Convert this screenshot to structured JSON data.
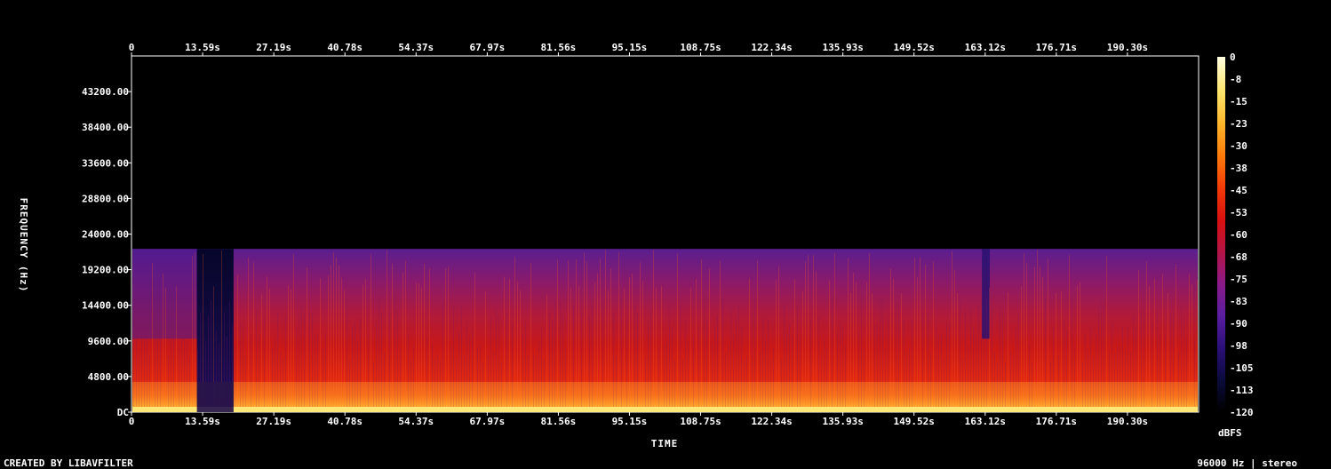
{
  "chart_data": {
    "type": "heatmap",
    "x_ticks": [
      "0",
      "13.59s",
      "27.19s",
      "40.78s",
      "54.37s",
      "67.97s",
      "81.56s",
      "95.15s",
      "108.75s",
      "122.34s",
      "135.93s",
      "149.52s",
      "163.12s",
      "176.71s",
      "190.30s"
    ],
    "x_tick_values": [
      0,
      13.59,
      27.19,
      40.78,
      54.37,
      67.97,
      81.56,
      95.15,
      108.75,
      122.34,
      135.93,
      149.52,
      163.12,
      176.71,
      190.3
    ],
    "xlim": [
      0,
      203.9
    ],
    "xlabel": "TIME",
    "y_ticks": [
      "DC",
      "4800.00",
      "9600.00",
      "14400.00",
      "19200.00",
      "24000.00",
      "28800.00",
      "33600.00",
      "38400.00",
      "43200.00"
    ],
    "y_tick_values": [
      0,
      4800,
      9600,
      14400,
      19200,
      24000,
      28800,
      33600,
      38400,
      43200
    ],
    "ylim": [
      0,
      48000
    ],
    "ylabel": "FREQUENCY (Hz)",
    "content_cutoff_hz": 22000,
    "colorbar": {
      "label": "dBFS",
      "ticks": [
        "0",
        "-8",
        "-15",
        "-23",
        "-30",
        "-38",
        "-45",
        "-53",
        "-60",
        "-68",
        "-75",
        "-83",
        "-90",
        "-98",
        "-105",
        "-113",
        "-120"
      ],
      "range": [
        -120,
        0
      ],
      "colors": [
        "#000000",
        "#0b0b3c",
        "#2a0f78",
        "#5a1ea0",
        "#8a1a8a",
        "#b41446",
        "#d81010",
        "#f23a08",
        "#ff7a0a",
        "#ffb42a",
        "#ffe46a",
        "#ffffe0"
      ]
    },
    "quiet_segments_s": [
      [
        12.5,
        19.5
      ]
    ],
    "dropout_s": [
      [
        162.5,
        164.0
      ]
    ]
  },
  "footer": {
    "left": "CREATED BY LIBAVFILTER",
    "right": "96000 Hz | stereo"
  }
}
